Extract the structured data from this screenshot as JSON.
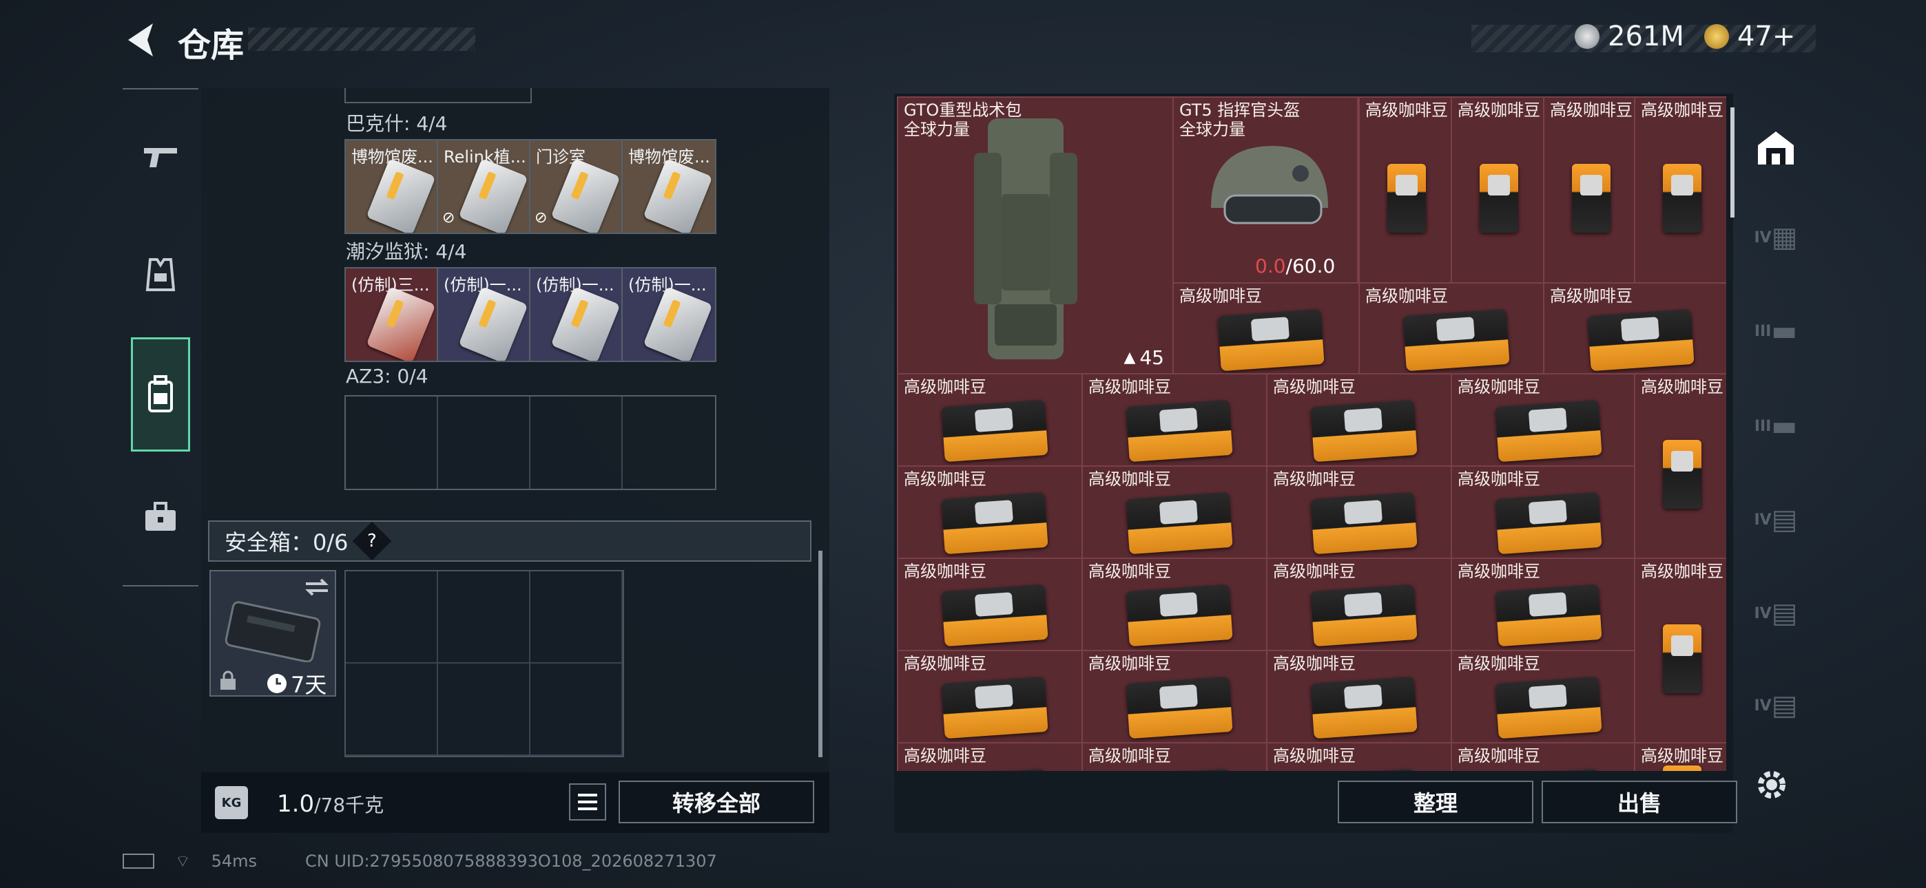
{
  "header": {
    "title": "仓库",
    "currency_silver": "261M",
    "currency_gold": "47+"
  },
  "left_nav": {
    "items": [
      {
        "name": "weapons"
      },
      {
        "name": "equipment"
      },
      {
        "name": "containers"
      },
      {
        "name": "tools"
      }
    ],
    "active_index": 2
  },
  "key_sections": [
    {
      "title": "巴克什: 4/4",
      "slots": [
        "博物馆废...",
        "Relink植...",
        "门诊室",
        "博物馆废..."
      ],
      "tone": "tan"
    },
    {
      "title": "潮汐监狱: 4/4",
      "slots": [
        "(仿制)三...",
        "(仿制)一...",
        "(仿制)一...",
        "(仿制)一..."
      ],
      "tone": "mixed"
    },
    {
      "title": "AZ3: 0/4",
      "slots": [
        "",
        "",
        "",
        ""
      ],
      "tone": "empty"
    }
  ],
  "safe_box": {
    "label": "安全箱：0/6",
    "help": "?",
    "duration": "7天"
  },
  "footer_left": {
    "kg_label": "KG",
    "weight_value": "1.0",
    "weight_max": "/78千克",
    "transfer_all": "转移全部"
  },
  "stash": {
    "backpack": {
      "name": "GTO重型战术包",
      "sub": "全球力量",
      "count": "45"
    },
    "helmet": {
      "name": "GT5 指挥官头盔",
      "sub": "全球力量",
      "durability_current": "0.0",
      "durability_max": "/60.0"
    },
    "item_name": "高级咖啡豆"
  },
  "footer_right": {
    "sort": "整理",
    "sell": "出售"
  },
  "right_nav": {
    "tiers": [
      "IV",
      "III",
      "III",
      "IV",
      "IV",
      "IV"
    ]
  },
  "status_bar": {
    "ping": "54ms",
    "uid": "CN UID:2795508075888393O108_202608271307"
  },
  "colors": {
    "accent": "#5fd8a8",
    "stash_bg": "#5a2a31",
    "durability_red": "#e14b4b"
  }
}
